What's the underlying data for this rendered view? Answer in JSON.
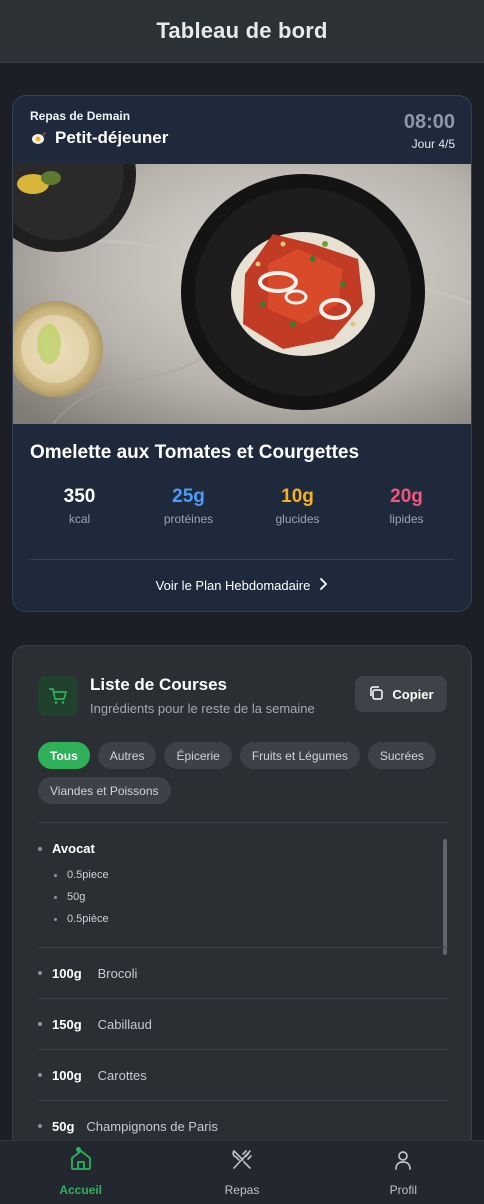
{
  "header": {
    "title": "Tableau de bord"
  },
  "meal": {
    "subtitle": "Repas de Demain",
    "icon": "frying-egg-icon",
    "title": "Petit-déjeuner",
    "time": "08:00",
    "day": "Jour 4/5",
    "dish": "Omelette aux Tomates et Courgettes",
    "macros": [
      {
        "value": "350",
        "label": "kcal",
        "color": "#ffffff"
      },
      {
        "value": "25g",
        "label": "protéines",
        "color": "#4f9af7"
      },
      {
        "value": "10g",
        "label": "glucides",
        "color": "#f5b21e"
      },
      {
        "value": "20g",
        "label": "lipides",
        "color": "#f0567a"
      }
    ],
    "weekly_link": "Voir le Plan Hebdomadaire"
  },
  "shopping": {
    "title": "Liste de Courses",
    "subtitle": "Ingrédients pour le reste de la semaine",
    "copy_label": "Copier",
    "filters": [
      "Tous",
      "Autres",
      "Épicerie",
      "Fruits et Légumes",
      "Sucrées",
      "Viandes et Poissons"
    ],
    "active_filter": "Tous",
    "avocado": {
      "name": "Avocat",
      "amounts": [
        "0.5piece",
        "50g",
        "0.5pièce"
      ]
    },
    "items": [
      {
        "qty": "100g",
        "name": "Brocoli"
      },
      {
        "qty": "150g",
        "name": "Cabillaud"
      },
      {
        "qty": "100g",
        "name": "Carottes"
      },
      {
        "qty": "50g",
        "name": "Champignons de Paris"
      }
    ]
  },
  "nav": {
    "items": [
      {
        "label": "Accueil",
        "icon": "home-icon",
        "active": true
      },
      {
        "label": "Repas",
        "icon": "fork-knife-icon",
        "active": false
      },
      {
        "label": "Profil",
        "icon": "user-icon",
        "active": false
      }
    ]
  },
  "colors": {
    "accent": "#2eb158",
    "card_bg": "#1e2a3c",
    "page_bg": "#1c2026"
  }
}
